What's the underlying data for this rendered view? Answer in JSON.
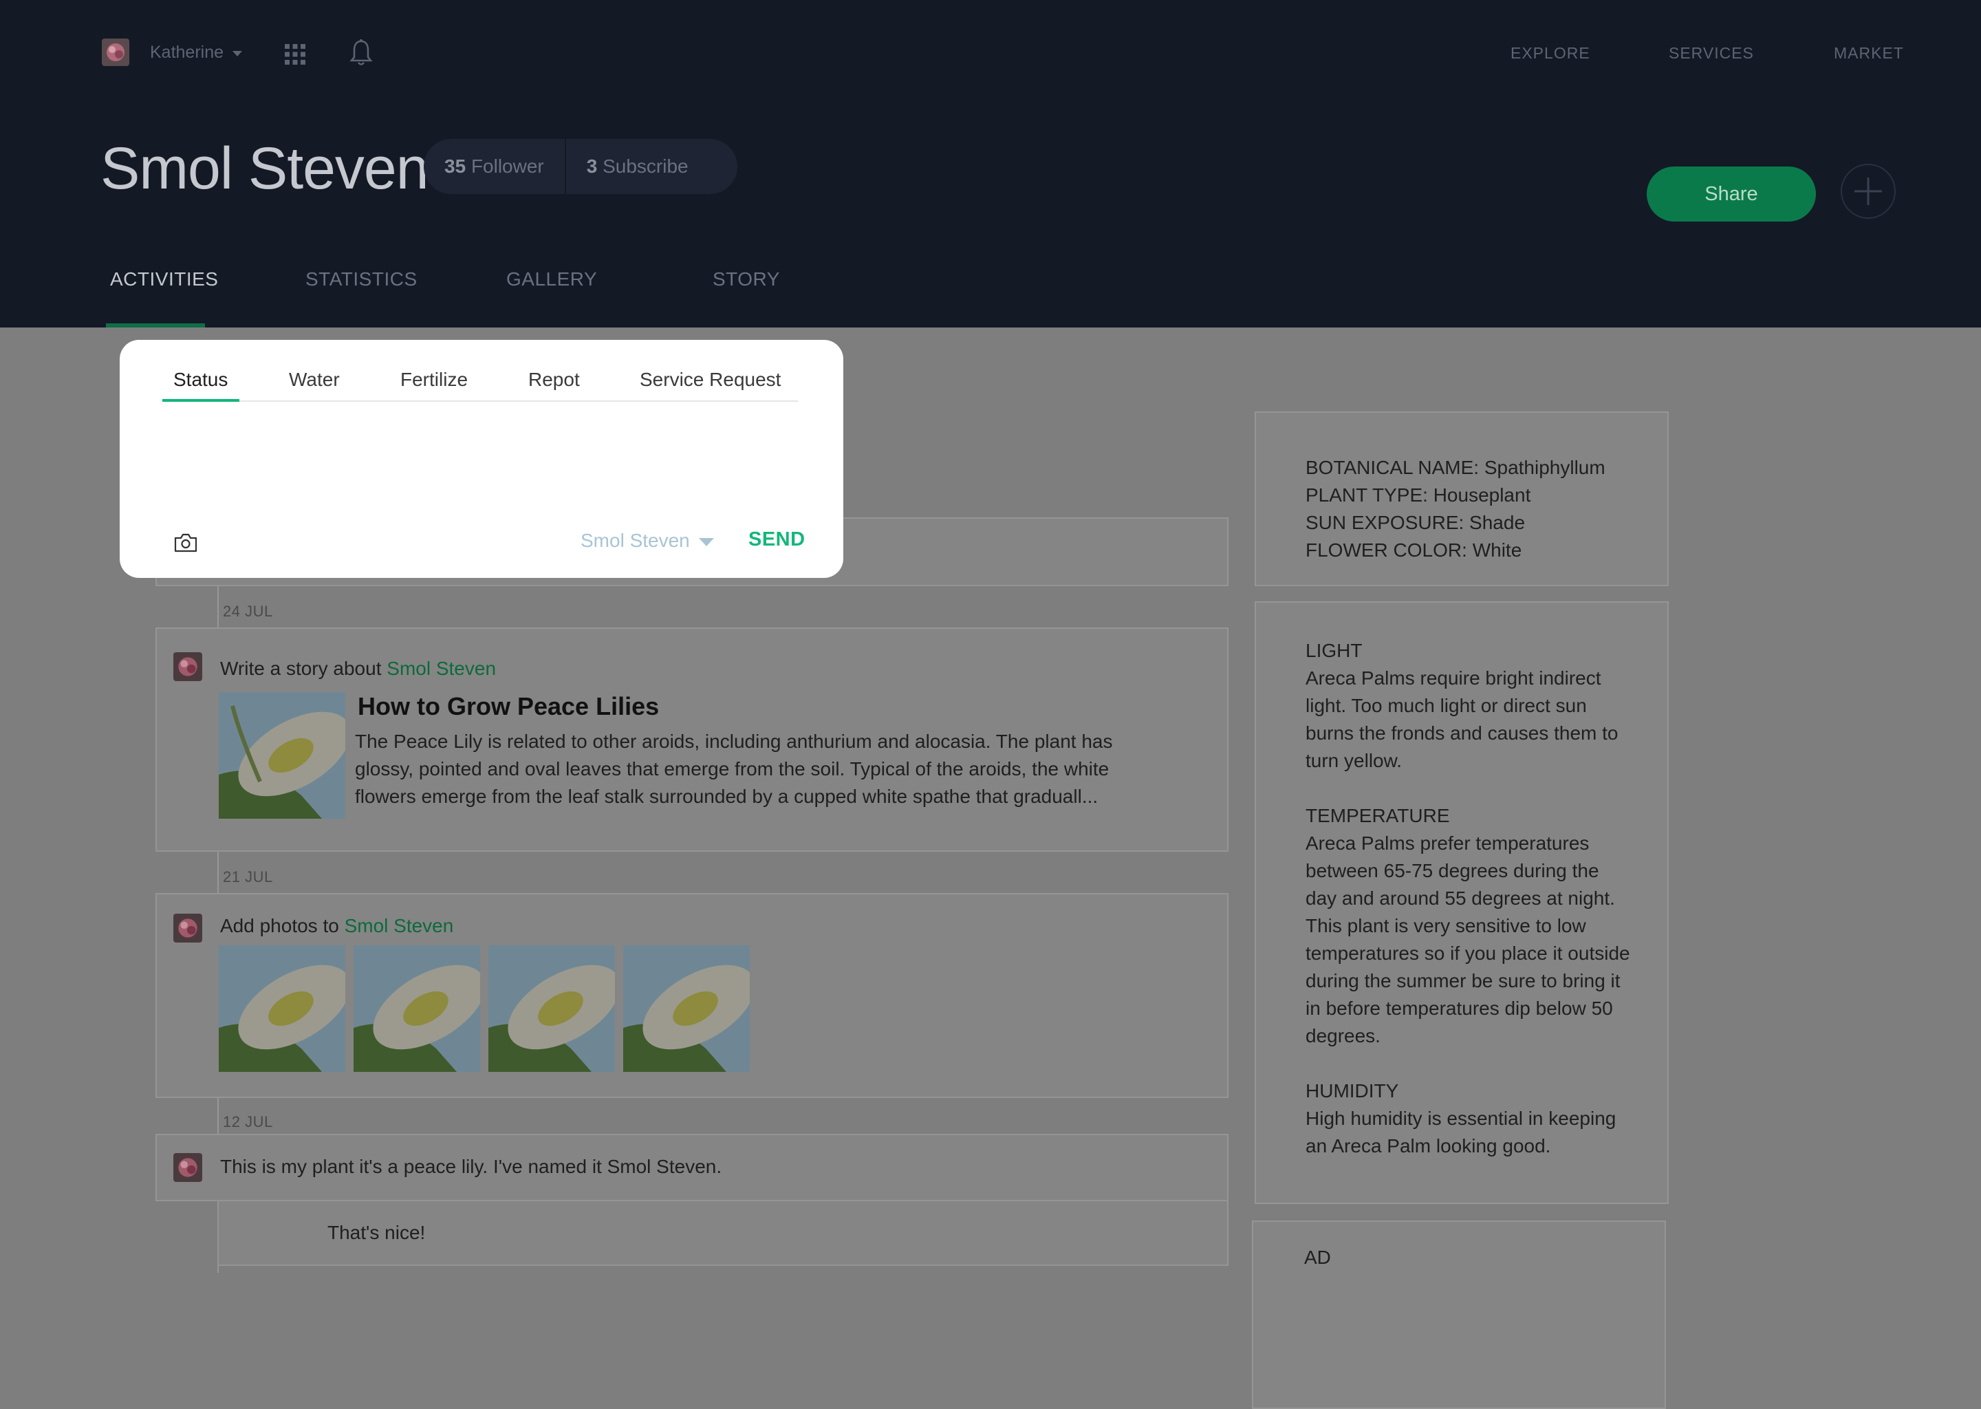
{
  "topbar": {
    "user_name": "Katherine",
    "nav": [
      "EXPLORE",
      "SERVICES",
      "MARKET"
    ]
  },
  "profile": {
    "title": "Smol Steven",
    "followers_count": "35",
    "followers_label": "Follower",
    "subscribe_count": "3",
    "subscribe_label": "Subscribe",
    "share_label": "Share"
  },
  "tabs": [
    "ACTIVITIES",
    "STATISTICS",
    "GALLERY",
    "STORY"
  ],
  "composer": {
    "tabs": [
      "Status",
      "Water",
      "Fertilize",
      "Repot",
      "Service Request"
    ],
    "author": "Smol Steven",
    "send_label": "SEND"
  },
  "feed": {
    "date_1": "24 JUL",
    "story_prefix": "Write a story about ",
    "story_link": "Smol Steven",
    "story_title": "How to Grow Peace Lilies",
    "story_body": "The Peace Lily is related to other aroids, including anthurium and alocasia. The plant has glossy, pointed and oval leaves that emerge from the soil. Typical of the aroids, the white flowers emerge from the leaf stalk surrounded by a cupped white spathe that graduall...",
    "date_2": "21 JUL",
    "photos_prefix": "Add photos to ",
    "photos_link": "Smol Steven",
    "date_3": "12 JUL",
    "post_text": "This is my plant it's a peace lily. I've named it Smol Steven.",
    "reply_text": "That's nice!"
  },
  "sidebar": {
    "facts": "BOTANICAL NAME: Spathiphyllum\nPLANT TYPE:  Houseplant\nSUN EXPOSURE:  Shade\nFLOWER COLOR:  White",
    "care": "LIGHT\nAreca Palms require bright indirect\nlight. Too much light or direct sun\nburns the fronds and causes them to\nturn yellow.\n\nTEMPERATURE\nAreca Palms prefer temperatures\nbetween 65-75 degrees during the\nday and around 55 degrees at night.\nThis plant is very sensitive to low\ntemperatures so if you place it outside\nduring the summer be sure to bring it\nin before temperatures dip below 50\ndegrees.\n\nHUMIDITY\nHigh humidity is essential in keeping\nan Areca Palm looking good.",
    "ad_label": "AD"
  },
  "colors": {
    "header_bg": "#141926",
    "accent_green": "#13b77a",
    "share_green": "#0b7a4b",
    "overlay_gray": "#7e7e7e"
  }
}
